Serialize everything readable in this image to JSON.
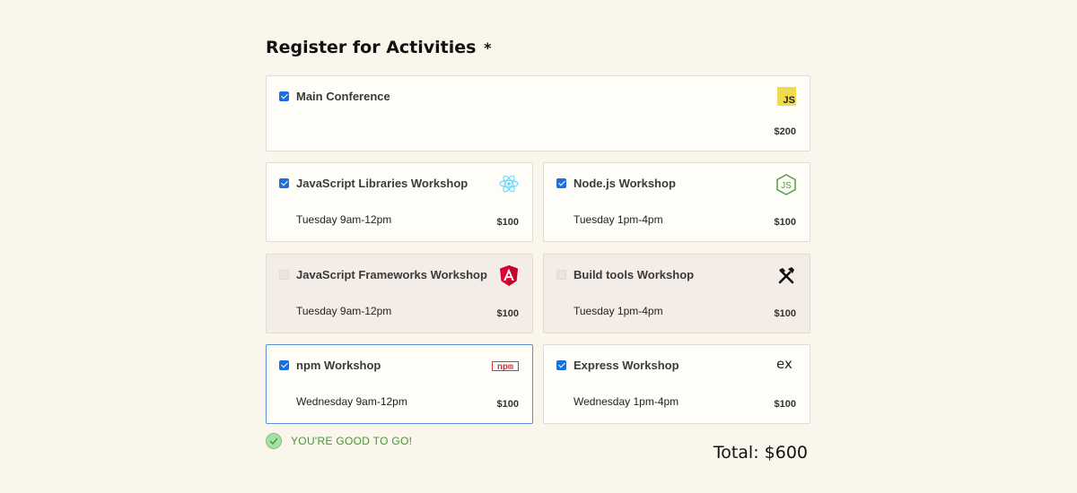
{
  "form": {
    "title": "Register for Activities",
    "required_mark": "*"
  },
  "activities": [
    {
      "name": "Main Conference",
      "time": "",
      "price": "$200",
      "checked": true,
      "disabled": false,
      "icon": "javascript-icon"
    },
    {
      "name": "JavaScript Libraries Workshop",
      "time": "Tuesday 9am-12pm",
      "price": "$100",
      "checked": true,
      "disabled": false,
      "icon": "react-icon"
    },
    {
      "name": "Node.js Workshop",
      "time": "Tuesday 1pm-4pm",
      "price": "$100",
      "checked": true,
      "disabled": false,
      "icon": "nodejs-icon"
    },
    {
      "name": "JavaScript Frameworks Workshop",
      "time": "Tuesday 9am-12pm",
      "price": "$100",
      "checked": false,
      "disabled": true,
      "icon": "angular-icon"
    },
    {
      "name": "Build tools Workshop",
      "time": "Tuesday 1pm-4pm",
      "price": "$100",
      "checked": false,
      "disabled": true,
      "icon": "tools-icon"
    },
    {
      "name": "npm Workshop",
      "time": "Wednesday 9am-12pm",
      "price": "$100",
      "checked": true,
      "disabled": false,
      "icon": "npm-icon"
    },
    {
      "name": "Express Workshop",
      "time": "Wednesday 1pm-4pm",
      "price": "$100",
      "checked": true,
      "disabled": false,
      "icon": "express-icon"
    }
  ],
  "status": {
    "message": "YOU'RE GOOD TO GO!",
    "icon": "check-circle-icon",
    "color": "#3d9a33"
  },
  "total": {
    "label": "Total: $600"
  },
  "colors": {
    "background": "#faf6ec",
    "checkbox": "#1d6fdc",
    "disabled_card": "#f4ece6",
    "focus_border": "#5b8fd6"
  }
}
